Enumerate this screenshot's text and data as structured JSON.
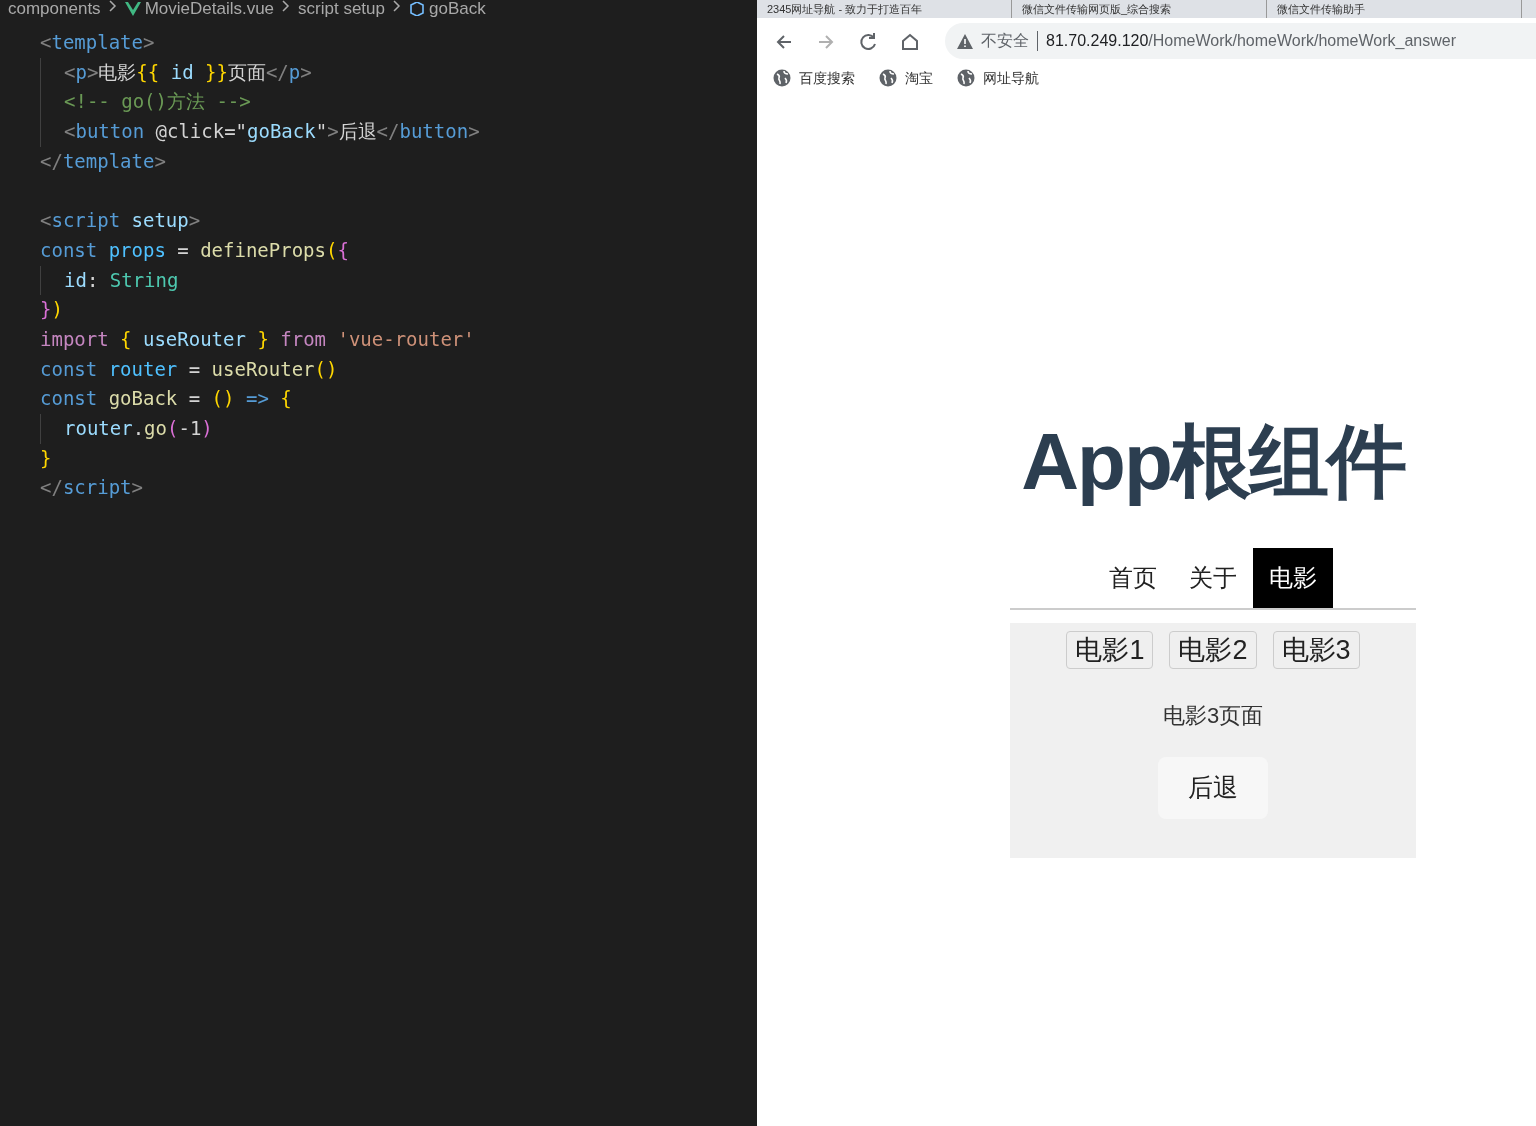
{
  "editor": {
    "breadcrumb": [
      {
        "kind": "folder",
        "label": "components"
      },
      {
        "kind": "vue",
        "label": "MovieDetails.vue"
      },
      {
        "kind": "braces",
        "label": "script setup"
      },
      {
        "kind": "symbol",
        "label": "goBack"
      }
    ],
    "lines": [
      {
        "tokens": [
          {
            "color": "#808080",
            "t": "<"
          },
          {
            "color": "#569cd6",
            "t": "template"
          },
          {
            "color": "#808080",
            "t": ">"
          }
        ],
        "children": [
          {
            "tokens": [
              {
                "color": "#808080",
                "t": "<"
              },
              {
                "color": "#569cd6",
                "t": "p"
              },
              {
                "color": "#808080",
                "t": ">"
              },
              {
                "color": "#d4d4d4",
                "t": "电影"
              },
              {
                "color": "#ffd700",
                "t": "{{"
              },
              {
                "color": "#9cdcfe",
                "t": " id "
              },
              {
                "color": "#ffd700",
                "t": "}}"
              },
              {
                "color": "#d4d4d4",
                "t": "页面"
              },
              {
                "color": "#808080",
                "t": "</"
              },
              {
                "color": "#569cd6",
                "t": "p"
              },
              {
                "color": "#808080",
                "t": ">"
              }
            ]
          },
          {
            "tokens": [
              {
                "color": "#6a9955",
                "t": "<!-- go()方法 -->"
              }
            ]
          },
          {
            "tokens": [
              {
                "color": "#808080",
                "t": "<"
              },
              {
                "color": "#569cd6",
                "t": "button"
              },
              {
                "color": "#d4d4d4",
                "t": " @click=\""
              },
              {
                "color": "#9cdcfe",
                "t": "goBack"
              },
              {
                "color": "#d4d4d4",
                "t": "\""
              },
              {
                "color": "#808080",
                "t": ">"
              },
              {
                "color": "#d4d4d4",
                "t": "后退"
              },
              {
                "color": "#808080",
                "t": "</"
              },
              {
                "color": "#569cd6",
                "t": "button"
              },
              {
                "color": "#808080",
                "t": ">"
              }
            ]
          }
        ]
      },
      {
        "tokens": [
          {
            "color": "#808080",
            "t": "</"
          },
          {
            "color": "#569cd6",
            "t": "template"
          },
          {
            "color": "#808080",
            "t": ">"
          }
        ]
      },
      {
        "blank_before": true,
        "tokens": [
          {
            "color": "#808080",
            "t": "<"
          },
          {
            "color": "#569cd6",
            "t": "script"
          },
          {
            "color": "#9cdcfe",
            "t": " setup"
          },
          {
            "color": "#808080",
            "t": ">"
          }
        ]
      },
      {
        "tokens": [
          {
            "color": "#569cd6",
            "t": "const"
          },
          {
            "color": "#4fc1ff",
            "t": " props"
          },
          {
            "color": "#d4d4d4",
            "t": " = "
          },
          {
            "color": "#dcdcaa",
            "t": "defineProps"
          },
          {
            "color": "#ffd700",
            "t": "("
          },
          {
            "color": "#da70d6",
            "t": "{"
          }
        ],
        "children": [
          {
            "tokens": [
              {
                "color": "#9cdcfe",
                "t": "id"
              },
              {
                "color": "#d4d4d4",
                "t": ": "
              },
              {
                "color": "#4ec9b0",
                "t": "String"
              }
            ]
          }
        ]
      },
      {
        "tokens": [
          {
            "color": "#da70d6",
            "t": "}"
          },
          {
            "color": "#ffd700",
            "t": ")"
          }
        ]
      },
      {
        "tokens": [
          {
            "color": "#c586c0",
            "t": "import "
          },
          {
            "color": "#ffd700",
            "t": "{"
          },
          {
            "color": "#9cdcfe",
            "t": " useRouter "
          },
          {
            "color": "#ffd700",
            "t": "}"
          },
          {
            "color": "#c586c0",
            "t": " from "
          },
          {
            "color": "#ce9178",
            "t": "'vue-router'"
          }
        ]
      },
      {
        "tokens": [
          {
            "color": "#569cd6",
            "t": "const"
          },
          {
            "color": "#4fc1ff",
            "t": " router"
          },
          {
            "color": "#d4d4d4",
            "t": " = "
          },
          {
            "color": "#dcdcaa",
            "t": "useRouter"
          },
          {
            "color": "#ffd700",
            "t": "()"
          }
        ]
      },
      {
        "tokens": [
          {
            "color": "#569cd6",
            "t": "const"
          },
          {
            "color": "#dcdcaa",
            "t": " goBack"
          },
          {
            "color": "#d4d4d4",
            "t": " = "
          },
          {
            "color": "#ffd700",
            "t": "()"
          },
          {
            "color": "#569cd6",
            "t": " => "
          },
          {
            "color": "#ffd700",
            "t": "{"
          }
        ],
        "children": [
          {
            "tokens": [
              {
                "color": "#9cdcfe",
                "t": "router"
              },
              {
                "color": "#d4d4d4",
                "t": "."
              },
              {
                "color": "#dcdcaa",
                "t": "go"
              },
              {
                "color": "#da70d6",
                "t": "("
              },
              {
                "color": "#d4d4d4",
                "t": "-1"
              },
              {
                "color": "#da70d6",
                "t": ")"
              }
            ]
          }
        ]
      },
      {
        "tokens": [
          {
            "color": "#ffd700",
            "t": "}"
          }
        ]
      },
      {
        "tokens": [
          {
            "color": "#808080",
            "t": "</"
          },
          {
            "color": "#569cd6",
            "t": "script"
          },
          {
            "color": "#808080",
            "t": ">"
          }
        ]
      }
    ]
  },
  "browser": {
    "tabs": [
      {
        "label": "2345网址导航 - 致力于打造百年",
        "selected": false
      },
      {
        "label": "微信文件传输网页版_综合搜索",
        "selected": false
      },
      {
        "label": "微信文件传输助手",
        "selected": false
      }
    ],
    "toolbar": [
      {
        "kind": "back",
        "disabled": false
      },
      {
        "kind": "forward",
        "disabled": true
      },
      {
        "kind": "reload",
        "disabled": false
      },
      {
        "kind": "home",
        "disabled": false
      }
    ],
    "address": {
      "security": "不安全",
      "host": "81.70.249.120",
      "path": "/HomeWork/homeWork/homeWork_answer"
    },
    "bookmarks": [
      "百度搜索",
      "淘宝",
      "网址导航"
    ],
    "page": {
      "title": "App根组件",
      "nav": [
        {
          "label": "首页",
          "selected": false
        },
        {
          "label": "关于",
          "selected": false
        },
        {
          "label": "电影",
          "selected": true
        }
      ],
      "movie_buttons": [
        "电影1",
        "电影2",
        "电影3"
      ],
      "text": "电影3页面",
      "back_button": "后退"
    }
  }
}
